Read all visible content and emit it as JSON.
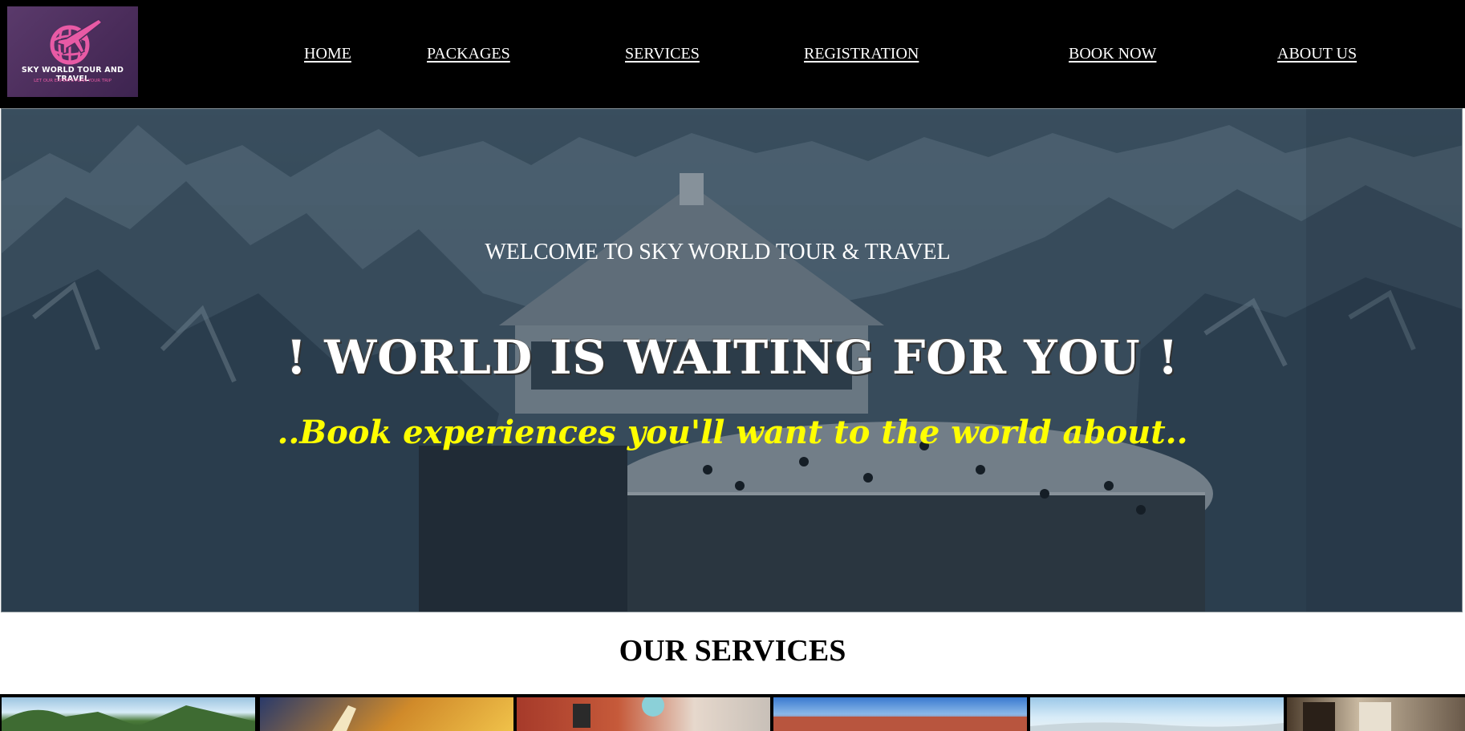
{
  "brand": {
    "name": "SKY WORLD TOUR AND TRAVEL",
    "tagline": "LET OUR EXPERTS PLAN YOUR TRIP",
    "colors": {
      "accent": "#e85aa5",
      "logo_bg": "#4a2c5a"
    }
  },
  "nav": {
    "items": [
      {
        "label": "HOME"
      },
      {
        "label": "PACKAGES"
      },
      {
        "label": "SERVICES"
      },
      {
        "label": "REGISTRATION"
      },
      {
        "label": "BOOK NOW"
      },
      {
        "label": "ABOUT US"
      }
    ]
  },
  "hero": {
    "welcome": "WELCOME TO SKY WORLD TOUR & TRAVEL",
    "headline": "! WORLD IS WAITING FOR YOU !",
    "tagline": "..Book experiences you'll want to the world about..",
    "tagline_color": "#ffff00"
  },
  "services": {
    "title": "OUR SERVICES",
    "tiles": [
      {
        "icon": "island-photo"
      },
      {
        "icon": "airplane-sunset-photo"
      },
      {
        "icon": "travel-agent-photo"
      },
      {
        "icon": "hotel-photo"
      },
      {
        "icon": "sky-landscape-photo"
      },
      {
        "icon": "interior-photo"
      }
    ]
  }
}
